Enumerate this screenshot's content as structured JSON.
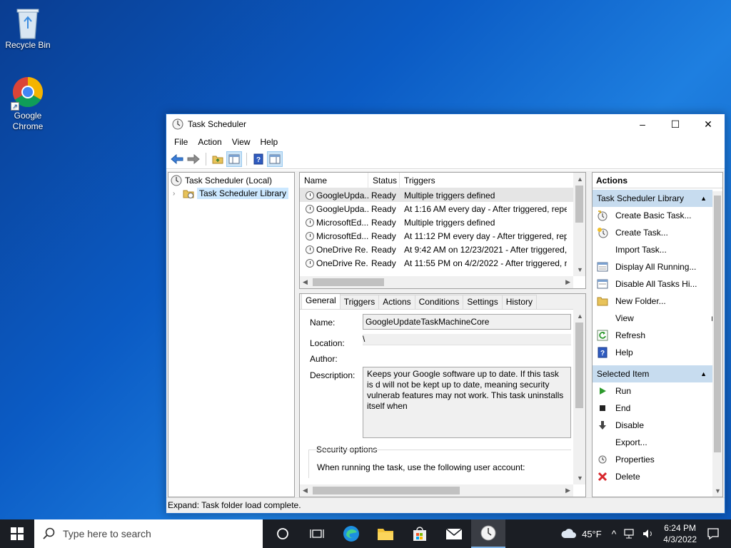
{
  "desktop": {
    "icons": [
      {
        "label": "Recycle Bin"
      },
      {
        "label": "Google Chrome"
      }
    ]
  },
  "window": {
    "title": "Task Scheduler",
    "controls": {
      "minimize": "–",
      "maximize": "☐",
      "close": "✕"
    },
    "menu": [
      "File",
      "Action",
      "View",
      "Help"
    ],
    "tree": {
      "root": "Task Scheduler (Local)",
      "library": "Task Scheduler Library"
    },
    "tasklist": {
      "columns": [
        "Name",
        "Status",
        "Triggers"
      ],
      "rows": [
        {
          "name": "GoogleUpda...",
          "status": "Ready",
          "triggers": "Multiple triggers defined"
        },
        {
          "name": "GoogleUpda...",
          "status": "Ready",
          "triggers": "At 1:16 AM every day - After triggered, repe"
        },
        {
          "name": "MicrosoftEd...",
          "status": "Ready",
          "triggers": "Multiple triggers defined"
        },
        {
          "name": "MicrosoftEd...",
          "status": "Ready",
          "triggers": "At 11:12 PM every day - After triggered, rep"
        },
        {
          "name": "OneDrive Re...",
          "status": "Ready",
          "triggers": "At 9:42 AM on 12/23/2021 - After triggered,"
        },
        {
          "name": "OneDrive Re...",
          "status": "Ready",
          "triggers": "At 11:55 PM on 4/2/2022 - After triggered, r"
        }
      ]
    },
    "details": {
      "tabs": [
        "General",
        "Triggers",
        "Actions",
        "Conditions",
        "Settings",
        "History"
      ],
      "name_label": "Name:",
      "name_value": "GoogleUpdateTaskMachineCore",
      "location_label": "Location:",
      "location_value": "\\",
      "author_label": "Author:",
      "description_label": "Description:",
      "description_value": "Keeps your Google software up to date. If this task is d will not be kept up to date, meaning security vulnerab features may not work. This task uninstalls itself when",
      "security_label": "Security options",
      "security_text": "When running the task, use the following user account:"
    },
    "actions": {
      "title": "Actions",
      "section1": "Task Scheduler Library",
      "items1": [
        {
          "label": "Create Basic Task...",
          "icon": "create-basic-task-icon"
        },
        {
          "label": "Create Task...",
          "icon": "create-task-icon"
        },
        {
          "label": "Import Task...",
          "icon": "none"
        },
        {
          "label": "Display All Running...",
          "icon": "running-icon"
        },
        {
          "label": "Disable All Tasks Hi...",
          "icon": "history-icon"
        },
        {
          "label": "New Folder...",
          "icon": "folder-icon"
        },
        {
          "label": "View",
          "icon": "none"
        },
        {
          "label": "Refresh",
          "icon": "refresh-icon"
        },
        {
          "label": "Help",
          "icon": "help-icon"
        }
      ],
      "section2": "Selected Item",
      "items2": [
        {
          "label": "Run",
          "icon": "run-icon"
        },
        {
          "label": "End",
          "icon": "end-icon"
        },
        {
          "label": "Disable",
          "icon": "disable-icon"
        },
        {
          "label": "Export...",
          "icon": "none"
        },
        {
          "label": "Properties",
          "icon": "properties-icon"
        },
        {
          "label": "Delete",
          "icon": "delete-icon"
        }
      ]
    },
    "status": "Expand:  Task folder load complete."
  },
  "taskbar": {
    "search_placeholder": "Type here to search",
    "weather": "45°F",
    "time": "6:24 PM",
    "date": "4/3/2022"
  },
  "colors": {
    "accent": "#1b6ac9",
    "section_header": "#c7dcef",
    "taskbar": "#1b1e24"
  }
}
